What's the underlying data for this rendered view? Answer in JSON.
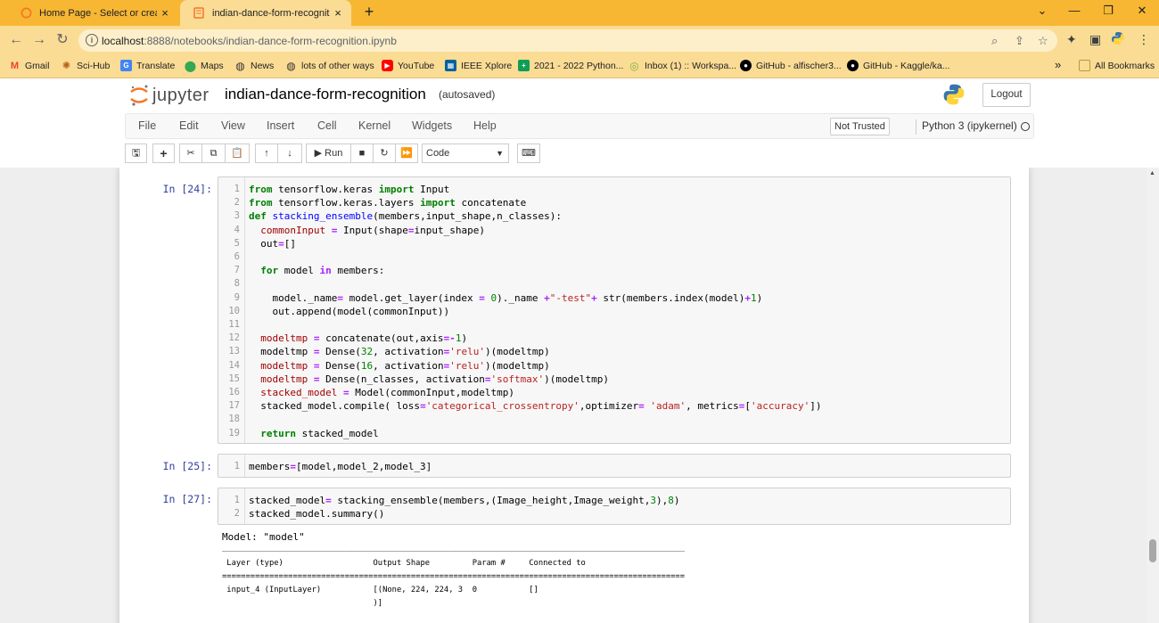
{
  "browser": {
    "tabs": [
      {
        "title": "Home Page - Select or create a n",
        "close": "×"
      },
      {
        "title": "indian-dance-form-recognition",
        "close": "×"
      }
    ],
    "new_tab": "+",
    "window_controls": {
      "menu": "⌄",
      "minimize": "—",
      "restore": "❐",
      "close": "✕"
    },
    "address": {
      "host": "localhost",
      "path": ":8888/notebooks/indian-dance-form-recognition.ipynb"
    },
    "bookmarks": [
      {
        "label": "Gmail",
        "icon": "gmail-icon",
        "color": "#ea4335"
      },
      {
        "label": "Sci-Hub",
        "icon": "scihub-icon",
        "color": "#b5651d"
      },
      {
        "label": "Translate",
        "icon": "translate-icon",
        "color": "#4285f4"
      },
      {
        "label": "Maps",
        "icon": "maps-icon",
        "color": "#34a853"
      },
      {
        "label": "News",
        "icon": "globe-icon",
        "color": "#333333"
      },
      {
        "label": "lots of other ways",
        "icon": "globe-icon",
        "color": "#333333"
      },
      {
        "label": "YouTube",
        "icon": "youtube-icon",
        "color": "#ff0000"
      },
      {
        "label": "IEEE Xplore",
        "icon": "ieee-icon",
        "color": "#00629b"
      },
      {
        "label": "2021 - 2022 Python...",
        "icon": "sheets-icon",
        "color": "#0f9d58"
      },
      {
        "label": "Inbox (1) :: Workspa...",
        "icon": "inbox-icon",
        "color": "#7cb342"
      },
      {
        "label": "GitHub - alfischer3...",
        "icon": "github-icon",
        "color": "#000000"
      },
      {
        "label": "GitHub - Kaggle/ka...",
        "icon": "github-icon",
        "color": "#000000"
      }
    ],
    "bookmarks_more": "»",
    "all_bookmarks": "All Bookmarks"
  },
  "jupyter": {
    "logo_text": "jupyter",
    "notebook_name": "indian-dance-form-recognition",
    "autosave": "(autosaved)",
    "logout": "Logout",
    "menus": [
      "File",
      "Edit",
      "View",
      "Insert",
      "Cell",
      "Kernel",
      "Widgets",
      "Help"
    ],
    "trust": "Not Trusted",
    "kernel": "Python 3 (ipykernel)",
    "run_label": "Run",
    "cell_type": "Code"
  },
  "cells": [
    {
      "prompt": "In [24]:",
      "lines": [
        "<span class=\"kw\">from</span> tensorflow.keras <span class=\"kw\">import</span> Input",
        "<span class=\"kw\">from</span> tensorflow.keras.layers <span class=\"kw\">import</span> concatenate",
        "<span class=\"kw\">def</span> <span class=\"def\">stacking_ensemble</span>(members,input_shape,n_classes):",
        "  <span class=\"var\">commonInput</span> <span class=\"op\">=</span> Input(shape<span class=\"op\">=</span>input_shape)",
        "  out<span class=\"op\">=</span>[]",
        "",
        "  <span class=\"kw\">for</span> model <span class=\"op\">in</span> members:",
        "",
        "    model._name<span class=\"op\">=</span> model.get_layer(index <span class=\"op\">=</span> <span class=\"num\">0</span>)._name <span class=\"op\">+</span><span class=\"str\">\"-test\"</span><span class=\"op\">+</span> str(members.index(model)<span class=\"op\">+</span><span class=\"num\">1</span>)",
        "    out.append(model(commonInput))",
        "",
        "  <span class=\"var\">modeltmp</span> <span class=\"op\">=</span> concatenate(out,axis<span class=\"op\">=-</span><span class=\"num\">1</span>)",
        "  modeltmp <span class=\"op\">=</span> Dense(<span class=\"num\">32</span>, activation<span class=\"op\">=</span><span class=\"str\">'relu'</span>)(modeltmp)",
        "  <span class=\"var\">modeltmp</span> <span class=\"op\">=</span> Dense(<span class=\"num\">16</span>, activation<span class=\"op\">=</span><span class=\"str\">'relu'</span>)(modeltmp)",
        "  <span class=\"var\">modeltmp</span> <span class=\"op\">=</span> Dense(n_classes, activation<span class=\"op\">=</span><span class=\"str\">'softmax'</span>)(modeltmp)",
        "  <span class=\"var\">stacked_model</span> <span class=\"op\">=</span> Model(commonInput,modeltmp)",
        "  stacked_model.compile( loss<span class=\"op\">=</span><span class=\"str\">'categorical_crossentropy'</span>,optimizer<span class=\"op\">=</span> <span class=\"str\">'adam'</span>, metrics<span class=\"op\">=</span>[<span class=\"str\">'accuracy'</span>])",
        "",
        "  <span class=\"kw\">return</span> stacked_model"
      ]
    },
    {
      "prompt": "In [25]:",
      "lines": [
        "members<span class=\"op\">=</span>[model,model_2,model_3]"
      ]
    },
    {
      "prompt": "In [27]:",
      "lines": [
        "stacked_model<span class=\"op\">=</span> stacking_ensemble(members,(Image_height,Image_weight,<span class=\"num\">3</span>),<span class=\"num\">8</span>)",
        "stacked_model.summary()"
      ]
    }
  ],
  "output": {
    "model_line": "Model: \"model\"",
    "rule_top": "__________________________________________________________________________________________________",
    "header": " Layer (type)                   Output Shape         Param #     Connected to                     ",
    "rule_mid": "==================================================================================================",
    "row1": " input_4 (InputLayer)           [(None, 224, 224, 3  0           []                               ",
    "row1_cont": "                                )]                                                                "
  }
}
